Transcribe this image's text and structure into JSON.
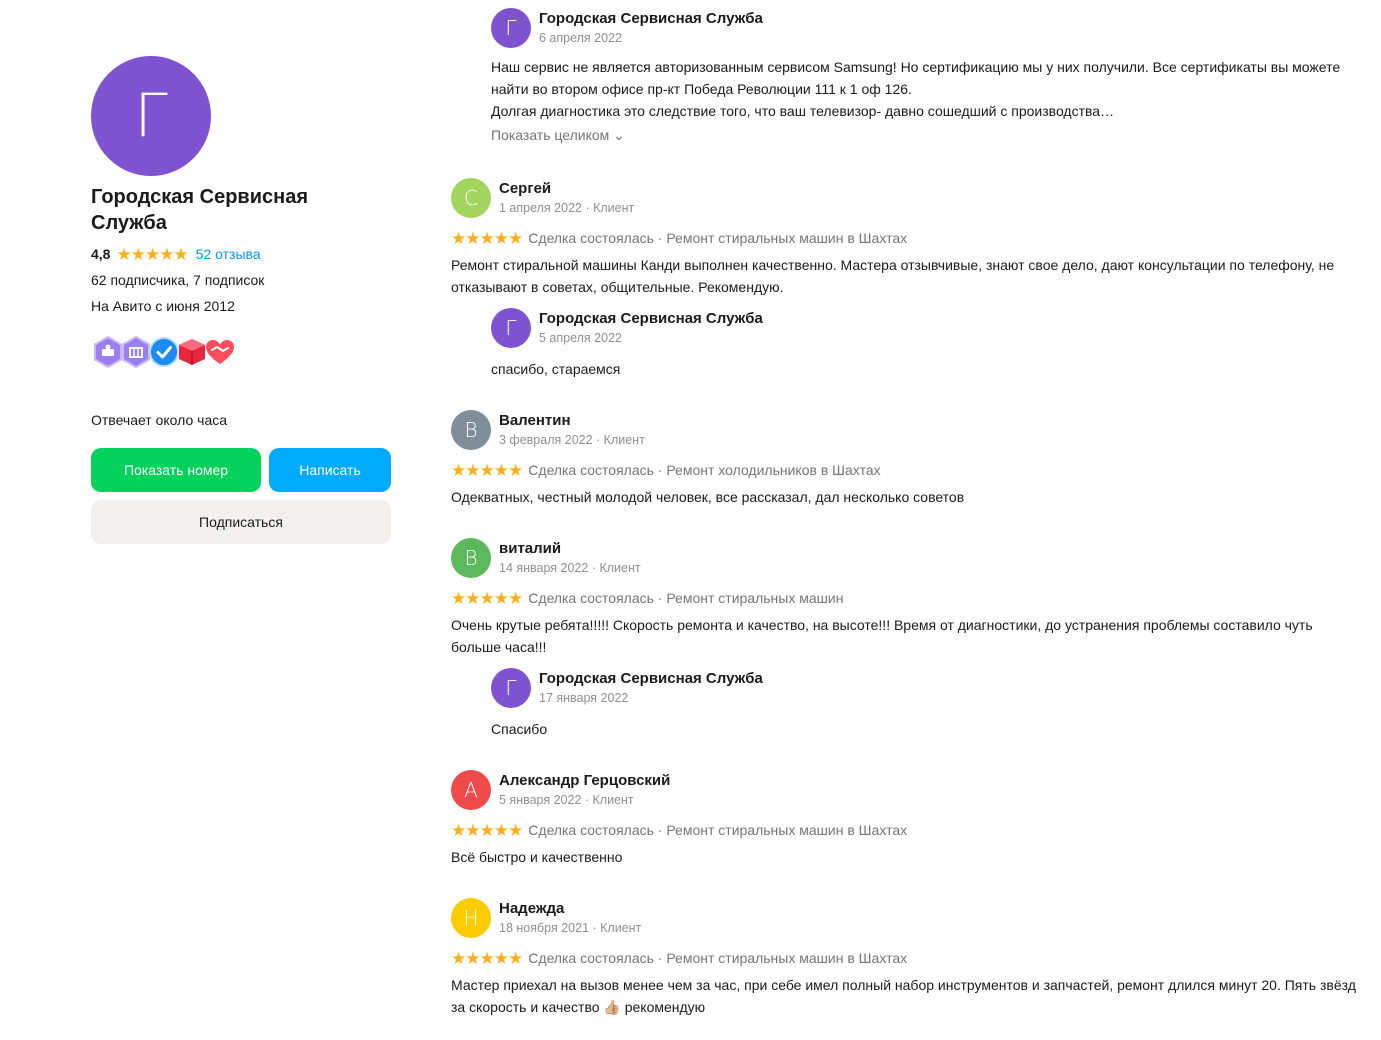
{
  "seller": {
    "avatar_letter": "Г",
    "avatar_color": "#7f52d1",
    "name": "Городская Сервисная Служба",
    "rating": "4,8",
    "stars": "★★★★★",
    "reviews_link": "52 отзыва",
    "followers": "62 подписчика, 7 подписок",
    "since": "На Авито с июня 2012",
    "badges": [
      "reliability-badge",
      "deals-badge",
      "verified-badge",
      "delivery-badge",
      "handshake-badge"
    ],
    "responds": "Отвечает около часа",
    "show_phone": "Показать номер",
    "write": "Написать",
    "subscribe": "Подписаться"
  },
  "reviews": [
    {
      "type": "reply",
      "avatar_letter": "Г",
      "avatar_color": "#7f52d1",
      "author": "Городская Сервисная Служба",
      "date": "6 апреля 2022",
      "text": "Наш сервис не является авторизованным сервисом Samsung! Но сертификацию мы у них получили. Все сертификаты вы можете найти во втором офисе пр-кт Победа Революции 111 к 1 оф 126.\nДолгая диагностика это следствие того, что ваш телевизор- давно сошедший с производства…",
      "show_more": "Показать целиком ⌄"
    },
    {
      "avatar_letter": "С",
      "avatar_color": "#a2d45e",
      "author": "Сергей",
      "date": "1 апреля 2022 · Клиент",
      "stars": "★★★★★",
      "deal": "Сделка состоялась · Ремонт стиральных машин в Шахтах",
      "text": "Ремонт стиральной машины Канди выполнен качественно. Мастера отзывчивые, знают свое дело, дают консультации по телефону, не отказывают в советах, общительные. Рекомендую.",
      "reply": {
        "avatar_letter": "Г",
        "avatar_color": "#7f52d1",
        "author": "Городская Сервисная Служба",
        "date": "5 апреля 2022",
        "text": "спасибо, стараемся"
      }
    },
    {
      "avatar_letter": "В",
      "avatar_color": "#7f8f99",
      "author": "Валентин",
      "date": "3 февраля 2022 · Клиент",
      "stars": "★★★★★",
      "deal": "Сделка состоялась · Ремонт холодильников в Шахтах",
      "text": "Одекватных, честный молодой человек, все рассказал, дал несколько советов"
    },
    {
      "avatar_letter": "В",
      "avatar_color": "#5cb85c",
      "author": "виталий",
      "date": "14 января 2022 · Клиент",
      "stars": "★★★★★",
      "deal": "Сделка состоялась · Ремонт стиральных машин",
      "text": "Очень крутые ребята!!!!! Скорость ремонта и качество, на высоте!!! Время от диагностики, до устранения проблемы составило чуть больше часа!!!",
      "reply": {
        "avatar_letter": "Г",
        "avatar_color": "#7f52d1",
        "author": "Городская Сервисная Служба",
        "date": "17 января 2022",
        "text": "Спасибо"
      }
    },
    {
      "avatar_letter": "А",
      "avatar_color": "#f04a4a",
      "author": "Александр Герцовский",
      "date": "5 января 2022 · Клиент",
      "stars": "★★★★★",
      "deal": "Сделка состоялась · Ремонт стиральных машин в Шахтах",
      "text": "Всё быстро и качественно"
    },
    {
      "avatar_letter": "Н",
      "avatar_color": "#ffcc00",
      "author": "Надежда",
      "date": "18 ноября 2021 · Клиент",
      "stars": "★★★★★",
      "deal": "Сделка состоялась · Ремонт стиральных машин в Шахтах",
      "text": "Мастер приехал на вызов менее чем за час, при себе имел полный набор инструментов и запчастей, ремонт длился минут 20. Пять звёзд за скорость и качество 👍🏼 рекомендую"
    }
  ]
}
